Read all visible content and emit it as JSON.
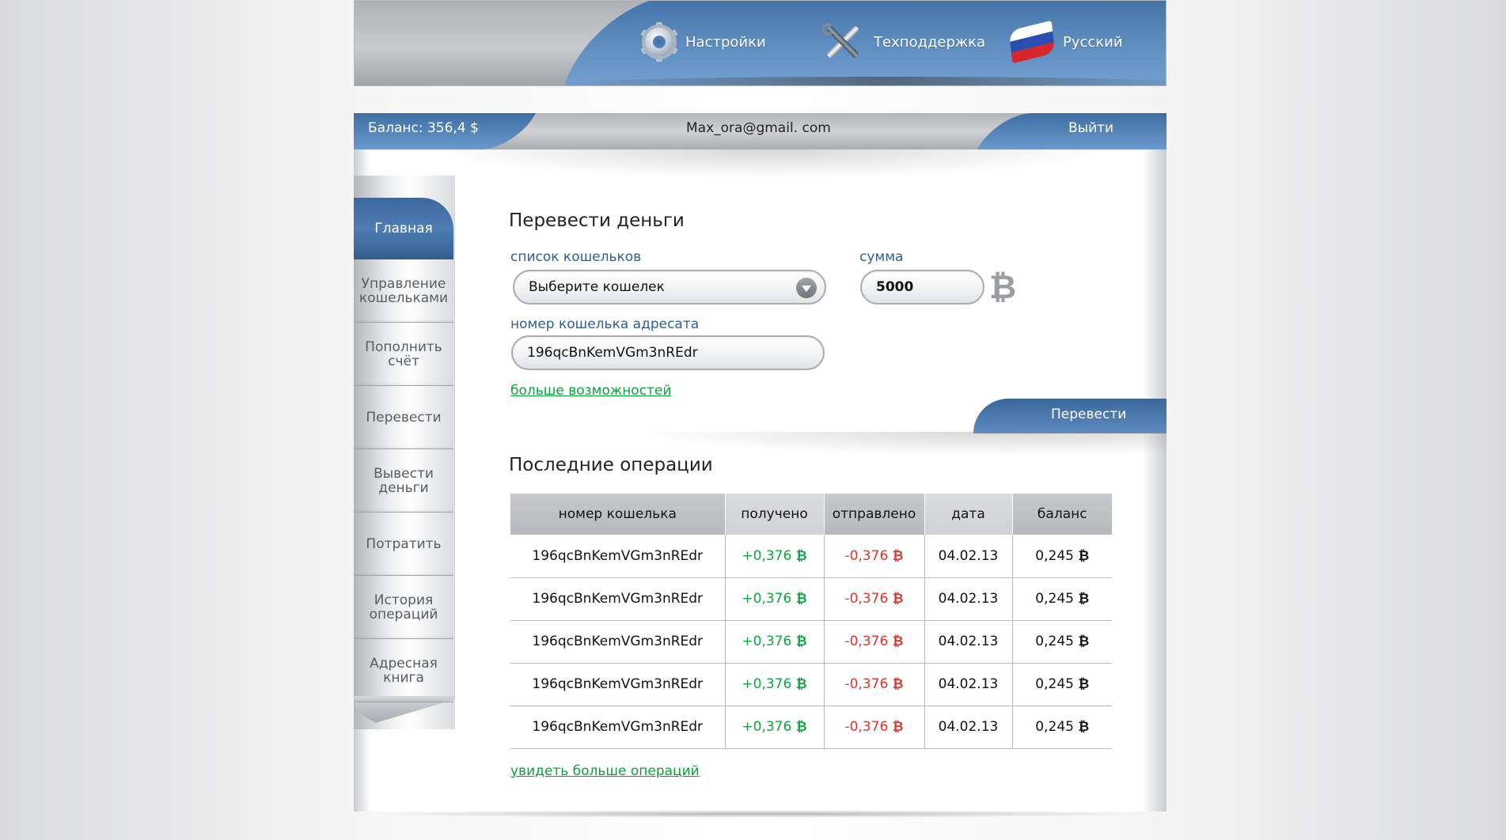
{
  "header": {
    "settings_label": "Настройки",
    "support_label": "Техподдержка",
    "language_label": "Русский"
  },
  "status_bar": {
    "balance": "Баланс: 356,4 $",
    "email": "Max_ora@gmail. com",
    "logout_label": "Выйти"
  },
  "sidebar": {
    "items": [
      {
        "label": "Главная",
        "active": true
      },
      {
        "label": "Управление кошельками"
      },
      {
        "label": "Пополнить счёт"
      },
      {
        "label": "Перевести"
      },
      {
        "label": "Вывести деньги"
      },
      {
        "label": "Потратить"
      },
      {
        "label": "История операций"
      },
      {
        "label": "Адресная книга"
      }
    ]
  },
  "transfer": {
    "title": "Перевести деньги",
    "wallet_list_label": "список кошельков",
    "wallet_select_value": "Выберите кошелек",
    "amount_label": "сумма",
    "amount_value": "5000",
    "currency_icon": "bitcoin-icon",
    "recipient_label": "номер кошелька адресата",
    "recipient_value": "196qcBnKemVGm3nREdr",
    "more_options_link": "больше возможностей",
    "send_button": "Перевести"
  },
  "operations": {
    "title": "Последние операции",
    "columns": [
      "номер кошелька",
      "получено",
      "отправлено",
      "дата",
      "баланс"
    ],
    "rows": [
      {
        "wallet": "196qcBnKemVGm3nREdr",
        "received": "+0,376",
        "sent": "-0,376",
        "date": "04.02.13",
        "balance": "0,245"
      },
      {
        "wallet": "196qcBnKemVGm3nREdr",
        "received": "+0,376",
        "sent": "-0,376",
        "date": "04.02.13",
        "balance": "0,245"
      },
      {
        "wallet": "196qcBnKemVGm3nREdr",
        "received": "+0,376",
        "sent": "-0,376",
        "date": "04.02.13",
        "balance": "0,245"
      },
      {
        "wallet": "196qcBnKemVGm3nREdr",
        "received": "+0,376",
        "sent": "-0,376",
        "date": "04.02.13",
        "balance": "0,245"
      },
      {
        "wallet": "196qcBnKemVGm3nREdr",
        "received": "+0,376",
        "sent": "-0,376",
        "date": "04.02.13",
        "balance": "0,245"
      }
    ],
    "btc_symbol": "₿",
    "more_link": "увидеть больше операций"
  },
  "colors": {
    "accent_blue": "#3f6fa4",
    "positive": "#12a344",
    "negative": "#d83a2d",
    "link_green": "#0aa23b"
  }
}
